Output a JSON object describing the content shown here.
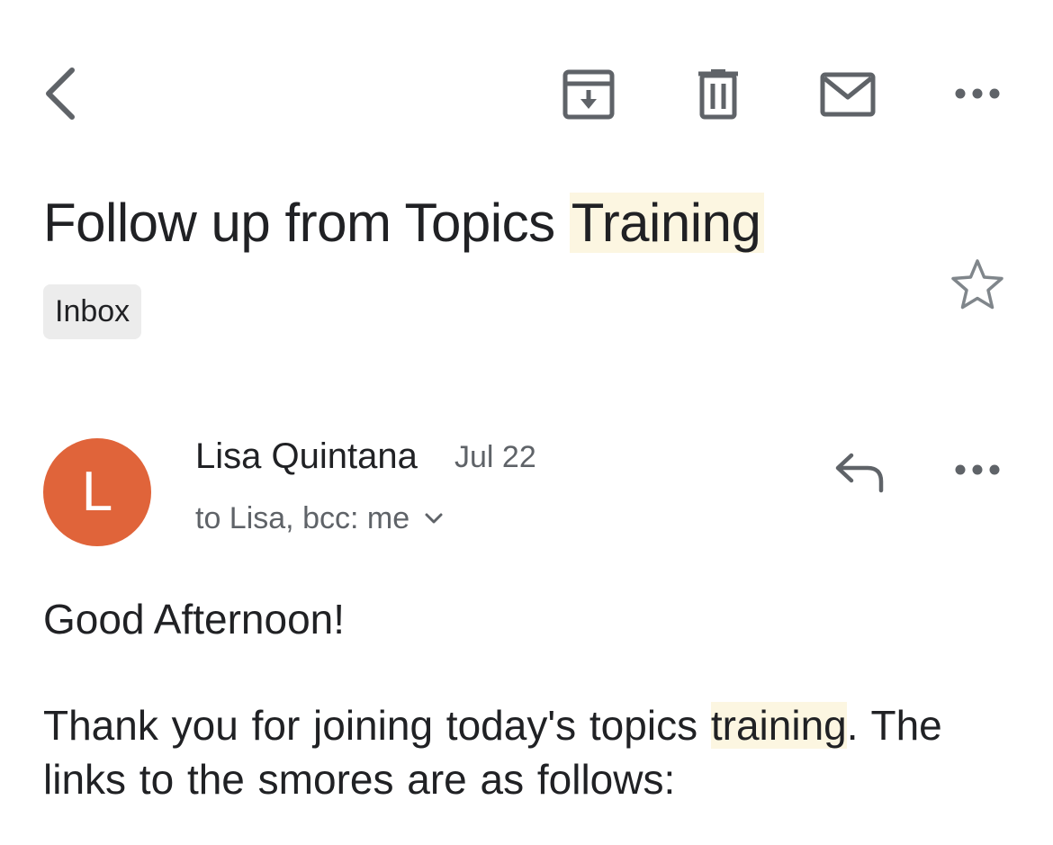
{
  "toolbar": {
    "back_icon": "chevron-left-icon",
    "archive_icon": "archive-icon",
    "delete_icon": "trash-icon",
    "mark_unread_icon": "mail-icon",
    "more_icon": "more-horizontal-icon"
  },
  "email": {
    "subject_prefix": "Follow up from Topics ",
    "subject_highlight": "Training",
    "label": "Inbox",
    "starred": false,
    "sender": {
      "initial": "L",
      "name": "Lisa Quintana",
      "date": "Jul 22",
      "recipients": "to Lisa, bcc: me",
      "avatar_color": "#e0643a"
    },
    "body": {
      "greeting": "Good Afternoon!",
      "para_before": "Thank you for joining today's topics ",
      "para_highlight": "training",
      "para_after": ".  The links to the smores are as follows:"
    }
  },
  "colors": {
    "highlight": "#fcf6e1",
    "chip_bg": "#ececec",
    "icon_gray": "#5f6368",
    "text": "#202124"
  }
}
